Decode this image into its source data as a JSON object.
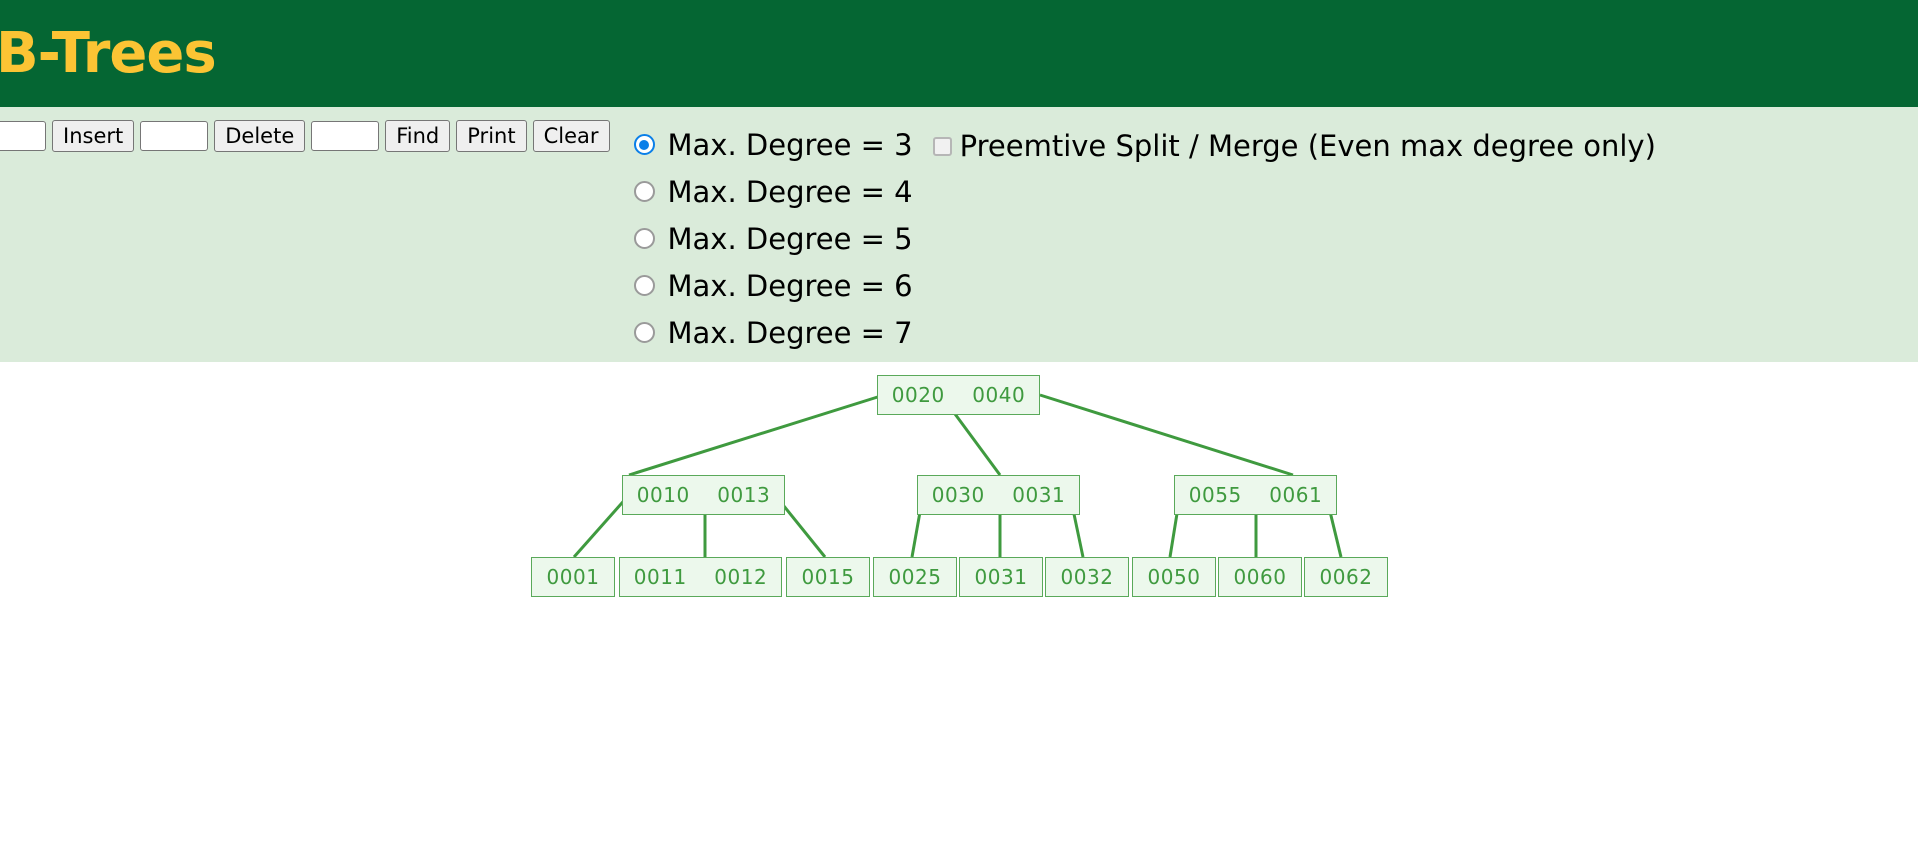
{
  "header": {
    "title": "B-Trees",
    "bg_color": "#056633",
    "text_color": "#fbc434"
  },
  "controls": {
    "panel_bg": "#daebda",
    "insert_input_value": "",
    "insert_input_placeholder": "",
    "insert_label": "Insert",
    "delete_input_value": "",
    "delete_input_placeholder": "",
    "delete_label": "Delete",
    "find_input_value": "",
    "find_input_placeholder": "",
    "find_label": "Find",
    "print_label": "Print",
    "clear_label": "Clear"
  },
  "degree_options": [
    {
      "label": "Max. Degree = 3",
      "value": "3",
      "selected": true
    },
    {
      "label": "Max. Degree = 4",
      "value": "4",
      "selected": false
    },
    {
      "label": "Max. Degree = 5",
      "value": "5",
      "selected": false
    },
    {
      "label": "Max. Degree = 6",
      "value": "6",
      "selected": false
    },
    {
      "label": "Max. Degree = 7",
      "value": "7",
      "selected": false
    }
  ],
  "preemptive": {
    "label": "Preemtive Split / Merge (Even max degree only)",
    "checked": false
  },
  "tree": {
    "node_fill": "#ecf8ec",
    "node_border": "#5aa95a",
    "key_color": "#3f9a3f",
    "edge_color": "#3f9a3f",
    "root": {
      "keys": [
        "0020",
        "0040"
      ]
    },
    "level2": [
      {
        "keys": [
          "0010",
          "0013"
        ]
      },
      {
        "keys": [
          "0030",
          "0031"
        ]
      },
      {
        "keys": [
          "0055",
          "0061"
        ]
      }
    ],
    "leaves": [
      {
        "keys": [
          "0001"
        ]
      },
      {
        "keys": [
          "0011",
          "0012"
        ]
      },
      {
        "keys": [
          "0015"
        ]
      },
      {
        "keys": [
          "0025"
        ]
      },
      {
        "keys": [
          "0031"
        ]
      },
      {
        "keys": [
          "0032"
        ]
      },
      {
        "keys": [
          "0050"
        ]
      },
      {
        "keys": [
          "0060"
        ]
      },
      {
        "keys": [
          "0062"
        ]
      }
    ]
  }
}
